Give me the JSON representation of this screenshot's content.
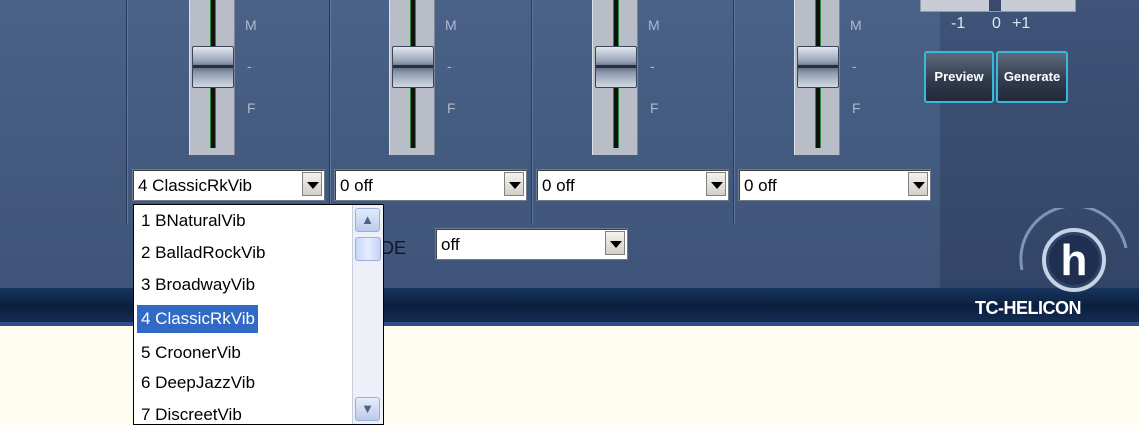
{
  "channels": [
    {
      "fader_labels": {
        "top": "M",
        "mid": "-",
        "bottom": "F"
      },
      "select_value": "4 ClassicRkVib"
    },
    {
      "fader_labels": {
        "top": "M",
        "mid": "-",
        "bottom": "F"
      },
      "select_value": "0 off"
    },
    {
      "fader_labels": {
        "top": "M",
        "mid": "-",
        "bottom": "F"
      },
      "select_value": "0 off"
    },
    {
      "fader_labels": {
        "top": "M",
        "mid": "-",
        "bottom": "F"
      },
      "select_value": "0 off"
    }
  ],
  "dropdown": {
    "items": [
      "1 BNaturalVib",
      "2 BalladRockVib",
      "3 BroadwayVib",
      "4 ClassicRkVib",
      "5 CroonerVib",
      "6 DeepJazzVib",
      "7 DiscreetVib"
    ],
    "selected": "4 ClassicRkVib"
  },
  "mode": {
    "label_partial": "DE",
    "value": "off"
  },
  "scale": {
    "minus": "-1",
    "zero": "0",
    "plus": "+1"
  },
  "buttons": {
    "preview": "Preview",
    "generate": "Generate"
  },
  "brand": {
    "logo_letter": "h",
    "name": "TC-HELICON"
  },
  "colors": {
    "panel": "#4a6288",
    "selection": "#316ac5",
    "button_border": "#39b8d8"
  }
}
